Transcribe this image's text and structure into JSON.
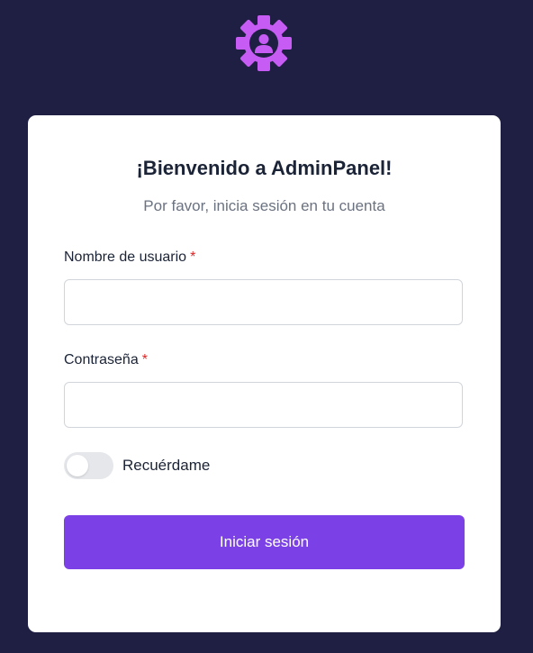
{
  "brand": {
    "logo_icon": "gear-user-icon",
    "logo_color": "#c75cf5"
  },
  "login": {
    "title": "¡Bienvenido a AdminPanel!",
    "subtitle": "Por favor, inicia sesión en tu cuenta",
    "username": {
      "label": "Nombre de usuario",
      "required_mark": "*",
      "value": ""
    },
    "password": {
      "label": "Contraseña",
      "required_mark": "*",
      "value": ""
    },
    "remember": {
      "label": "Recuérdame",
      "checked": false
    },
    "submit_label": "Iniciar sesión"
  },
  "colors": {
    "page_background": "#1f1f44",
    "accent": "#7b41e6",
    "required": "#dc2626"
  }
}
